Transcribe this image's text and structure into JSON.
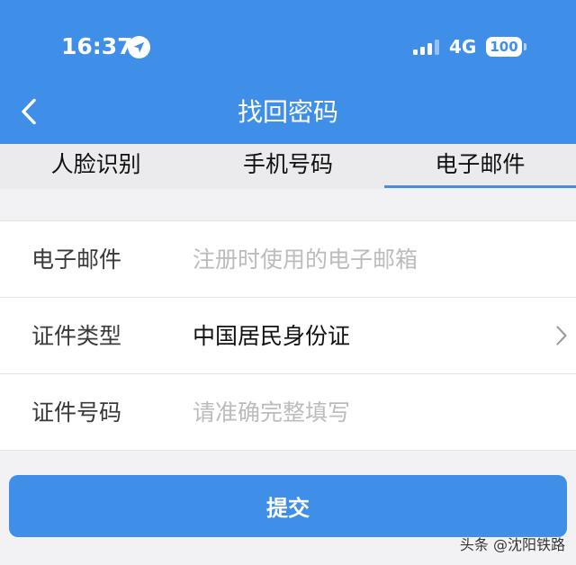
{
  "status_bar": {
    "time": "16:37",
    "network": "4G",
    "battery": "100",
    "signal_strength": 3,
    "signal_max": 4,
    "location_icon": "location-arrow-icon",
    "signal_icon": "signal-icon",
    "battery_icon": "battery-icon"
  },
  "nav": {
    "back_icon": "chevron-left-icon",
    "title": "找回密码"
  },
  "tabs": [
    {
      "label": "人脸识别",
      "selected": false
    },
    {
      "label": "手机号码",
      "selected": false
    },
    {
      "label": "电子邮件",
      "selected": true
    }
  ],
  "form": {
    "email": {
      "label": "电子邮件",
      "placeholder": "注册时使用的电子邮箱",
      "value": ""
    },
    "id_type": {
      "label": "证件类型",
      "value": "中国居民身份证",
      "icon": "chevron-right-icon"
    },
    "id_number": {
      "label": "证件号码",
      "placeholder": "请准确完整填写",
      "value": ""
    }
  },
  "submit": {
    "label": "提交"
  },
  "watermark": {
    "text": "头条 @沈阳铁路"
  },
  "theme": {
    "primary": "#3f8fe9",
    "tab_bg": "#ebebed",
    "page_bg": "#f2f2f4",
    "placeholder": "#bcbcbc"
  }
}
